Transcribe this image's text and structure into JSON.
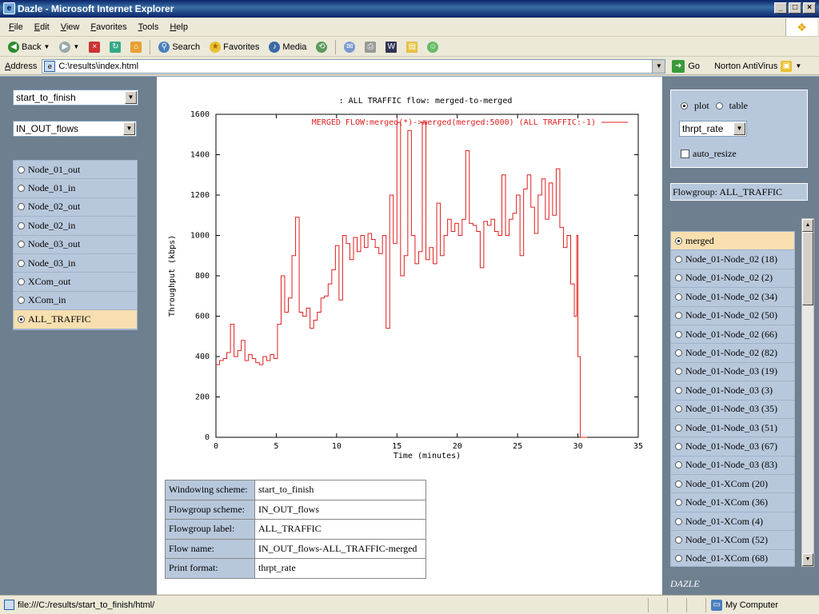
{
  "window": {
    "title": "Dazle - Microsoft Internet Explorer"
  },
  "menu": [
    "File",
    "Edit",
    "View",
    "Favorites",
    "Tools",
    "Help"
  ],
  "toolbar": {
    "back": "Back",
    "search": "Search",
    "favorites": "Favorites",
    "media": "Media"
  },
  "address": {
    "label": "Address",
    "url": "C:\\results\\index.html",
    "go": "Go",
    "antivirus": "Norton AntiVirus"
  },
  "left": {
    "window_select": "start_to_finish",
    "scheme_select": "IN_OUT_flows",
    "flows": [
      {
        "label": "Node_01_out",
        "selected": false
      },
      {
        "label": "Node_01_in",
        "selected": false
      },
      {
        "label": "Node_02_out",
        "selected": false
      },
      {
        "label": "Node_02_in",
        "selected": false
      },
      {
        "label": "Node_03_out",
        "selected": false
      },
      {
        "label": "Node_03_in",
        "selected": false
      },
      {
        "label": "XCom_out",
        "selected": false
      },
      {
        "label": "XCom_in",
        "selected": false
      },
      {
        "label": "ALL_TRAFFIC",
        "selected": true
      }
    ]
  },
  "right": {
    "mode_plot": "plot",
    "mode_table": "table",
    "format_select": "thrpt_rate",
    "auto_resize": "auto_resize",
    "flowgroup": "Flowgroup: ALL_TRAFFIC",
    "flows": [
      {
        "label": "merged",
        "selected": true
      },
      {
        "label": "Node_01-Node_02 (18)",
        "selected": false
      },
      {
        "label": "Node_01-Node_02 (2)",
        "selected": false
      },
      {
        "label": "Node_01-Node_02 (34)",
        "selected": false
      },
      {
        "label": "Node_01-Node_02 (50)",
        "selected": false
      },
      {
        "label": "Node_01-Node_02 (66)",
        "selected": false
      },
      {
        "label": "Node_01-Node_02 (82)",
        "selected": false
      },
      {
        "label": "Node_01-Node_03 (19)",
        "selected": false
      },
      {
        "label": "Node_01-Node_03 (3)",
        "selected": false
      },
      {
        "label": "Node_01-Node_03 (35)",
        "selected": false
      },
      {
        "label": "Node_01-Node_03 (51)",
        "selected": false
      },
      {
        "label": "Node_01-Node_03 (67)",
        "selected": false
      },
      {
        "label": "Node_01-Node_03 (83)",
        "selected": false
      },
      {
        "label": "Node_01-XCom (20)",
        "selected": false
      },
      {
        "label": "Node_01-XCom (36)",
        "selected": false
      },
      {
        "label": "Node_01-XCom (4)",
        "selected": false
      },
      {
        "label": "Node_01-XCom (52)",
        "selected": false
      },
      {
        "label": "Node_01-XCom (68)",
        "selected": false
      }
    ],
    "brand": "DAZLE"
  },
  "info": [
    {
      "key": "Windowing scheme:",
      "value": "start_to_finish"
    },
    {
      "key": "Flowgroup scheme:",
      "value": "IN_OUT_flows"
    },
    {
      "key": "Flowgroup label:",
      "value": "ALL_TRAFFIC"
    },
    {
      "key": "Flow name:",
      "value": "IN_OUT_flows-ALL_TRAFFIC-merged"
    },
    {
      "key": "Print format:",
      "value": "thrpt_rate"
    }
  ],
  "status": {
    "url": "file:///C:/results/start_to_finish/html/",
    "zone": "My Computer"
  },
  "chart_data": {
    "type": "line",
    "title": ": ALL TRAFFIC flow: merged-to-merged",
    "xlabel": "Time (minutes)",
    "ylabel": "Throughput (kbps)",
    "xlim": [
      0,
      35
    ],
    "ylim": [
      0,
      1600
    ],
    "xticks": [
      0,
      5,
      10,
      15,
      20,
      25,
      30,
      35
    ],
    "yticks": [
      0,
      200,
      400,
      600,
      800,
      1000,
      1200,
      1400,
      1600
    ],
    "grid": false,
    "legend_position": "top-right",
    "series": [
      {
        "name": "MERGED FLOW:merged(*)->merged(merged:5000) (ALL TRAFFIC:-1)",
        "color": "#e02020",
        "x": [
          0,
          0.3,
          0.6,
          0.9,
          1.2,
          1.5,
          1.8,
          2.1,
          2.4,
          2.7,
          3.0,
          3.3,
          3.6,
          3.9,
          4.2,
          4.5,
          4.8,
          5.1,
          5.4,
          5.7,
          6.0,
          6.3,
          6.6,
          6.9,
          7.2,
          7.5,
          7.8,
          8.1,
          8.4,
          8.7,
          9.0,
          9.3,
          9.6,
          9.9,
          10.2,
          10.5,
          10.8,
          11.1,
          11.4,
          11.7,
          12.0,
          12.3,
          12.6,
          12.9,
          13.2,
          13.5,
          13.8,
          14.1,
          14.4,
          14.7,
          15.0,
          15.3,
          15.6,
          15.9,
          16.2,
          16.5,
          16.8,
          17.1,
          17.4,
          17.7,
          18.0,
          18.3,
          18.6,
          18.9,
          19.2,
          19.5,
          19.8,
          20.1,
          20.4,
          20.7,
          21.0,
          21.3,
          21.6,
          21.9,
          22.2,
          22.5,
          22.8,
          23.1,
          23.4,
          23.7,
          24.0,
          24.3,
          24.6,
          24.9,
          25.2,
          25.5,
          25.8,
          26.1,
          26.4,
          26.7,
          27.0,
          27.3,
          27.6,
          27.9,
          28.2,
          28.5,
          28.8,
          29.1,
          29.4,
          29.7,
          29.9,
          30.0,
          30.2,
          30.5
        ],
        "y": [
          360,
          380,
          390,
          420,
          560,
          400,
          430,
          480,
          380,
          410,
          390,
          370,
          360,
          400,
          380,
          410,
          390,
          560,
          800,
          620,
          690,
          900,
          1090,
          620,
          600,
          640,
          540,
          580,
          620,
          690,
          700,
          760,
          830,
          950,
          680,
          1000,
          960,
          880,
          990,
          920,
          1000,
          940,
          1010,
          980,
          940,
          910,
          1000,
          540,
          1200,
          960,
          1560,
          800,
          900,
          1520,
          1000,
          860,
          920,
          1560,
          880,
          940,
          860,
          1160,
          900,
          1000,
          1080,
          1020,
          1060,
          1000,
          1080,
          1420,
          1060,
          1050,
          1020,
          840,
          1070,
          1050,
          1080,
          1020,
          1000,
          1300,
          1000,
          1080,
          1110,
          1200,
          900,
          1230,
          1300,
          1140,
          1010,
          1200,
          1280,
          1080,
          1260,
          1100,
          1330,
          1040,
          940,
          1000,
          760,
          600,
          1000,
          400,
          0,
          0
        ]
      }
    ]
  }
}
